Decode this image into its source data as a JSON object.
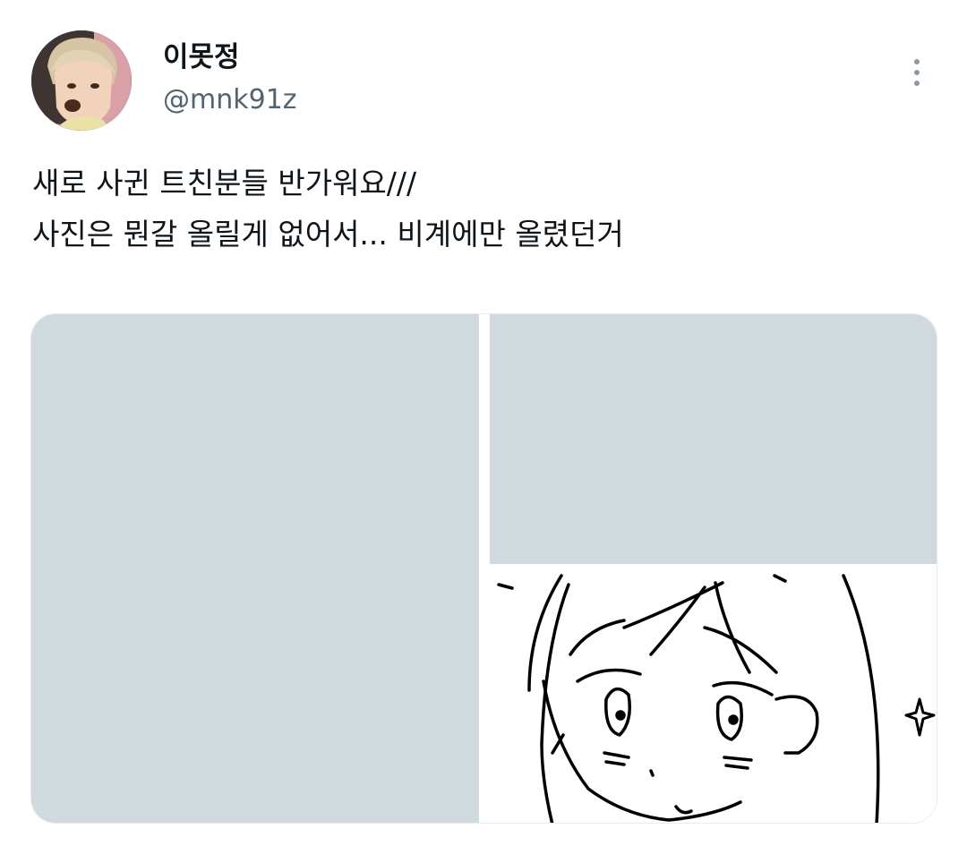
{
  "author": {
    "display_name": "이못정",
    "handle": "@mnk91z"
  },
  "tweet": {
    "lines": [
      "새로 사귄 트친분들 반가워요///",
      "사진은 뭔갈 올릴게 없어서... 비계에만 올렸던거"
    ]
  },
  "media": [
    {
      "kind": "image-placeholder"
    },
    {
      "kind": "image-placeholder"
    },
    {
      "kind": "sketch-drawing"
    }
  ],
  "icons": {
    "more": "more-vertical-icon"
  },
  "colors": {
    "text": "#0f1419",
    "secondary": "#536471",
    "placeholder": "#cfd9de",
    "more_dots": "#8b98a5"
  }
}
